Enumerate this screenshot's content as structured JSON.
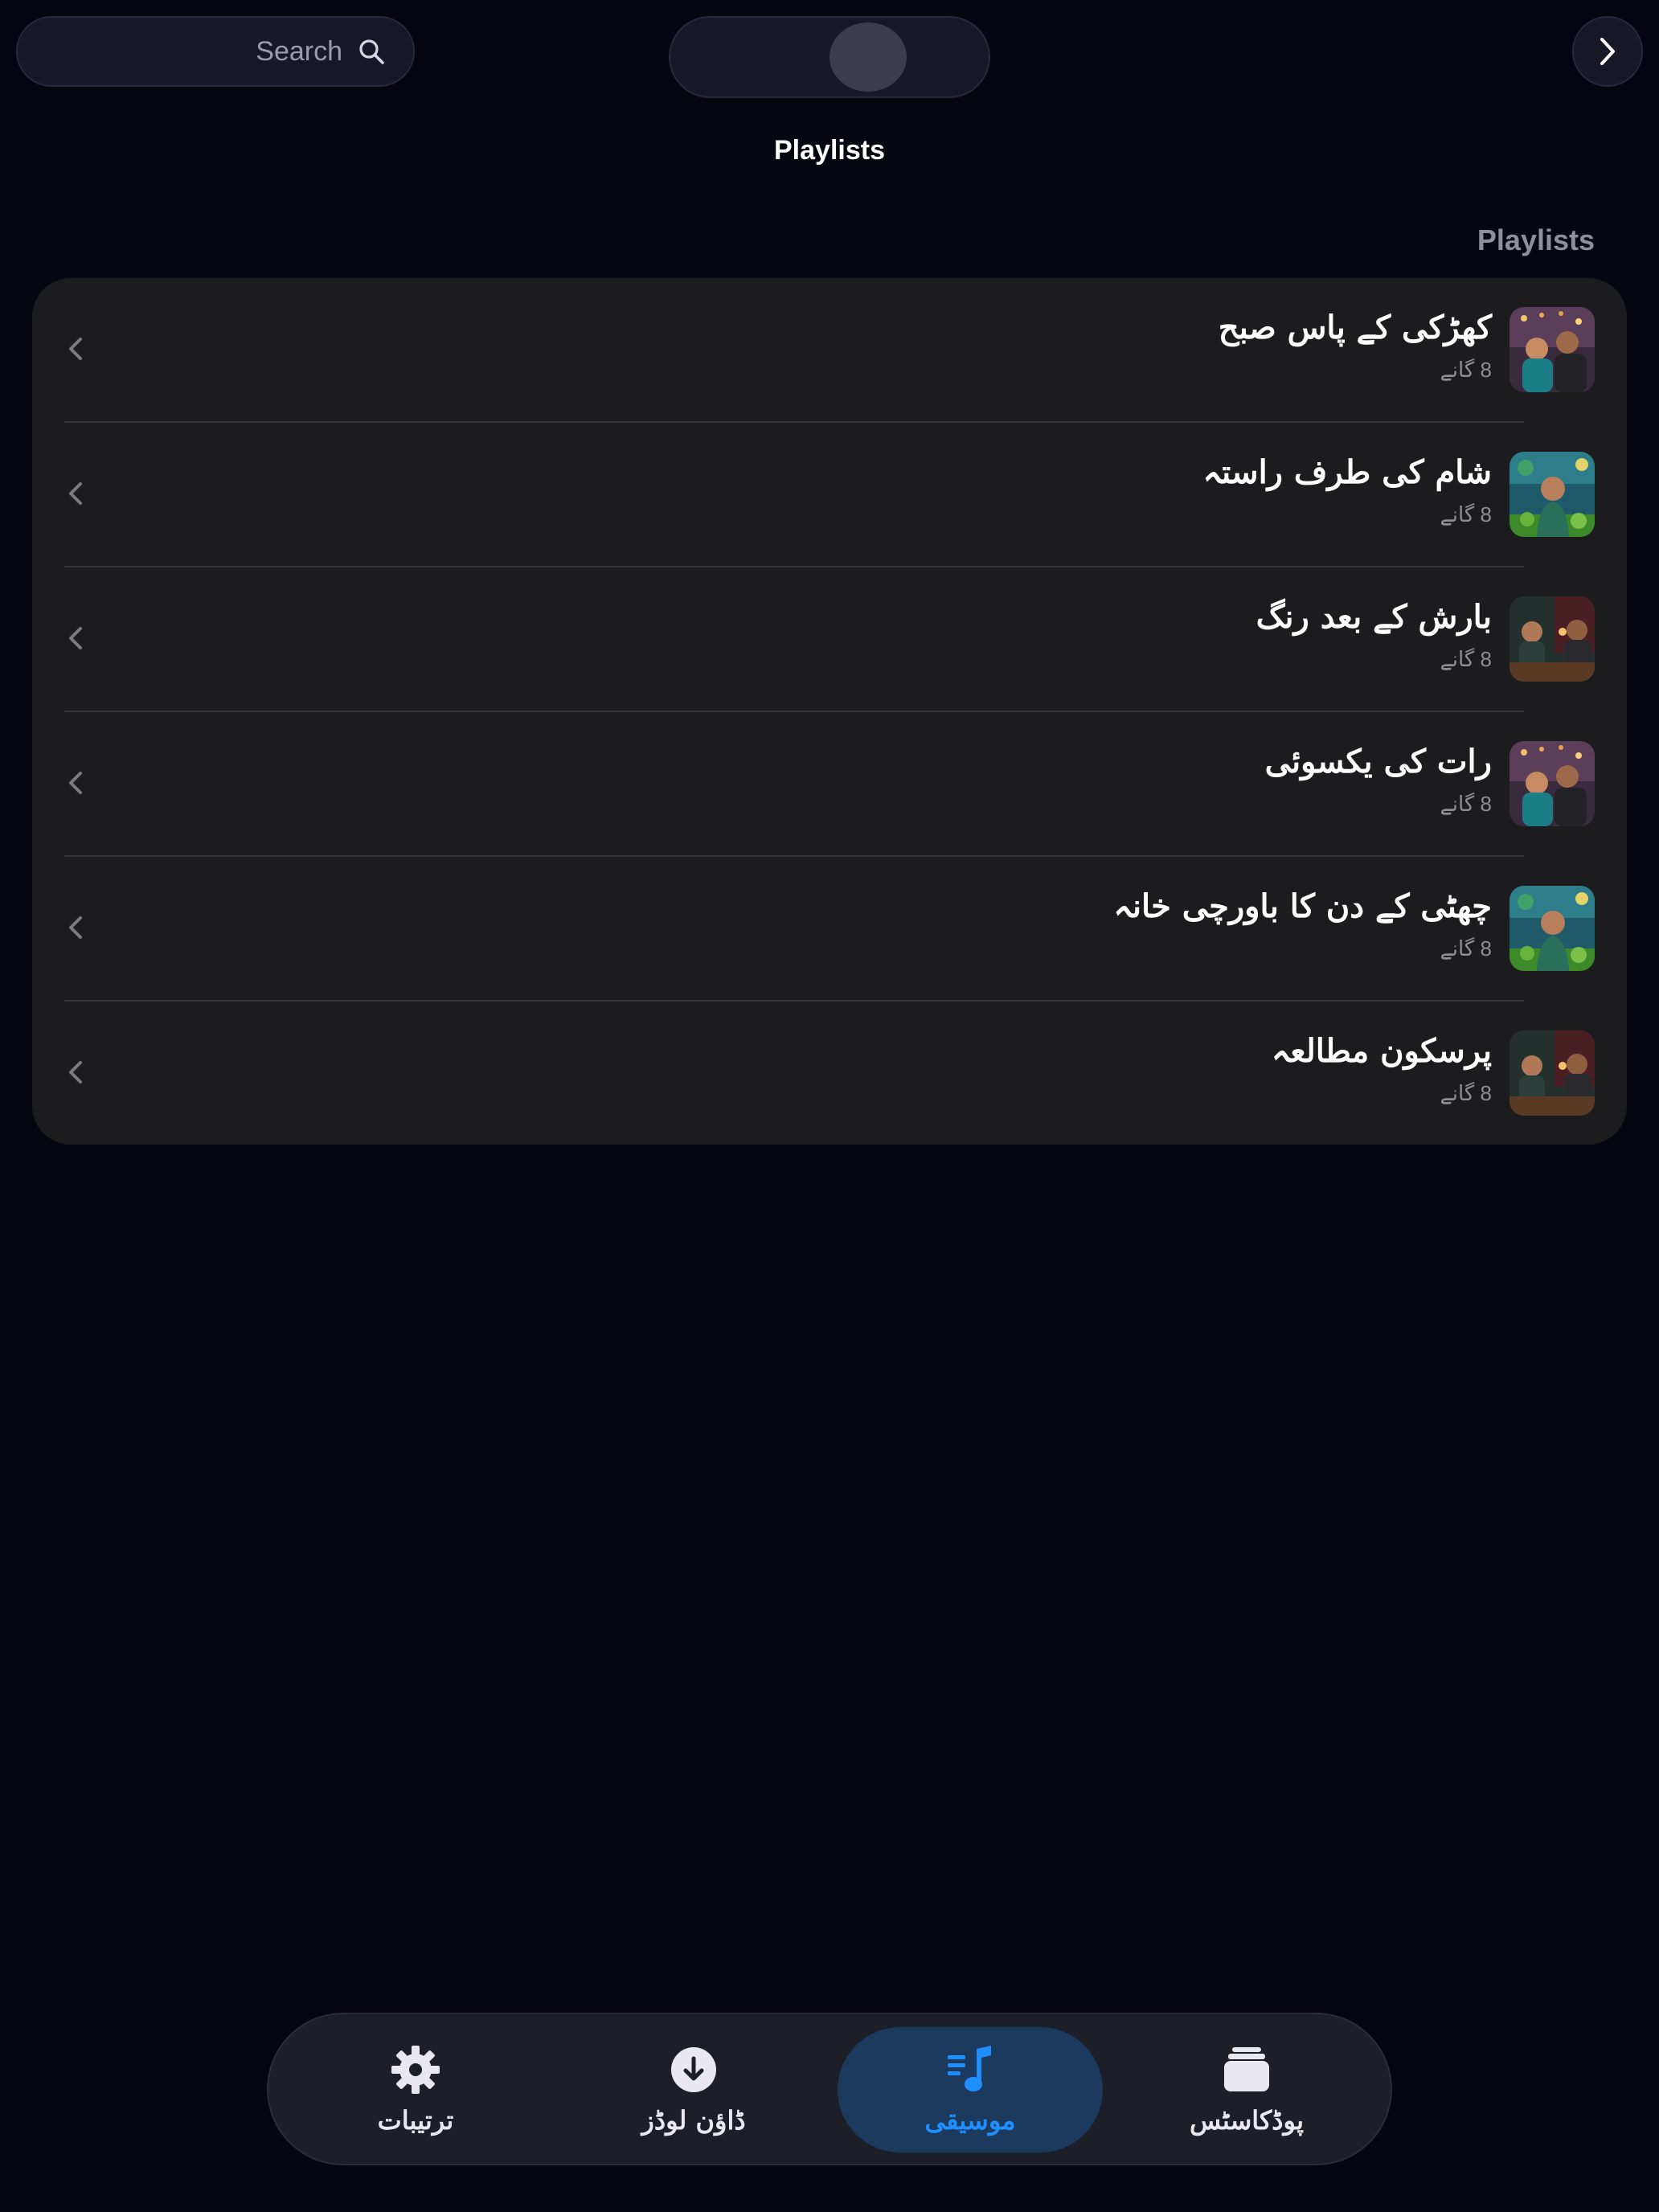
{
  "header": {
    "search_placeholder": "Search",
    "title": "Playlists",
    "section_title": "Playlists",
    "search_icon": "search-icon",
    "forward_icon": "chevron-right-icon"
  },
  "playlists": [
    {
      "title": "کھڑکی کے پاس صبح",
      "subtitle": "8 گانے",
      "thumb": "couple-lights"
    },
    {
      "title": "شام کی طرف راستہ",
      "subtitle": "8 گانے",
      "thumb": "woman-mural"
    },
    {
      "title": "بارش کے بعد رنگ",
      "subtitle": "8 گانے",
      "thumb": "couple-cafe"
    },
    {
      "title": "رات کی یکسوئی",
      "subtitle": "8 گانے",
      "thumb": "couple-lights"
    },
    {
      "title": "چھٹی کے دن کا باورچی خانہ",
      "subtitle": "8 گانے",
      "thumb": "woman-mural"
    },
    {
      "title": "پرسکون مطالعہ",
      "subtitle": "8 گانے",
      "thumb": "couple-cafe"
    }
  ],
  "tabs": [
    {
      "label": "ترتیبات",
      "icon": "gear-icon",
      "active": false
    },
    {
      "label": "ڈاؤن لوڈز",
      "icon": "download-icon",
      "active": false
    },
    {
      "label": "موسیقی",
      "icon": "music-note-icon",
      "active": true
    },
    {
      "label": "پوڈکاسٹس",
      "icon": "podcast-stack-icon",
      "active": false
    }
  ],
  "colors": {
    "background": "#05060f",
    "card": "#1c1c1e",
    "accent": "#1f8fff",
    "active_tab_bg": "#1b3a5e"
  }
}
